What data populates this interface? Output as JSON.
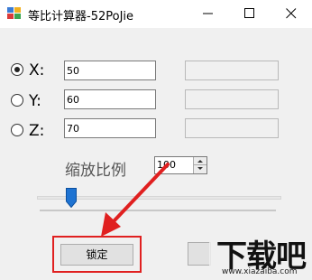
{
  "window": {
    "title": "等比计算器-52PoJie",
    "icons": [
      "app-icon",
      "minimize-icon",
      "maximize-icon",
      "close-icon"
    ]
  },
  "axes": [
    {
      "label": "X:",
      "value": "50",
      "selected": true,
      "result": ""
    },
    {
      "label": "Y:",
      "value": "60",
      "selected": false,
      "result": ""
    },
    {
      "label": "Z:",
      "value": "70",
      "selected": false,
      "result": ""
    }
  ],
  "scale": {
    "label": "缩放比例",
    "value": "100"
  },
  "slider": {
    "level": 0.1
  },
  "buttons": {
    "lock_label": "锁定"
  },
  "annotation": {
    "highlight_color": "#e02020"
  },
  "watermark": {
    "logo_text": "下载吧",
    "url": "www.xiazaiba.com"
  }
}
